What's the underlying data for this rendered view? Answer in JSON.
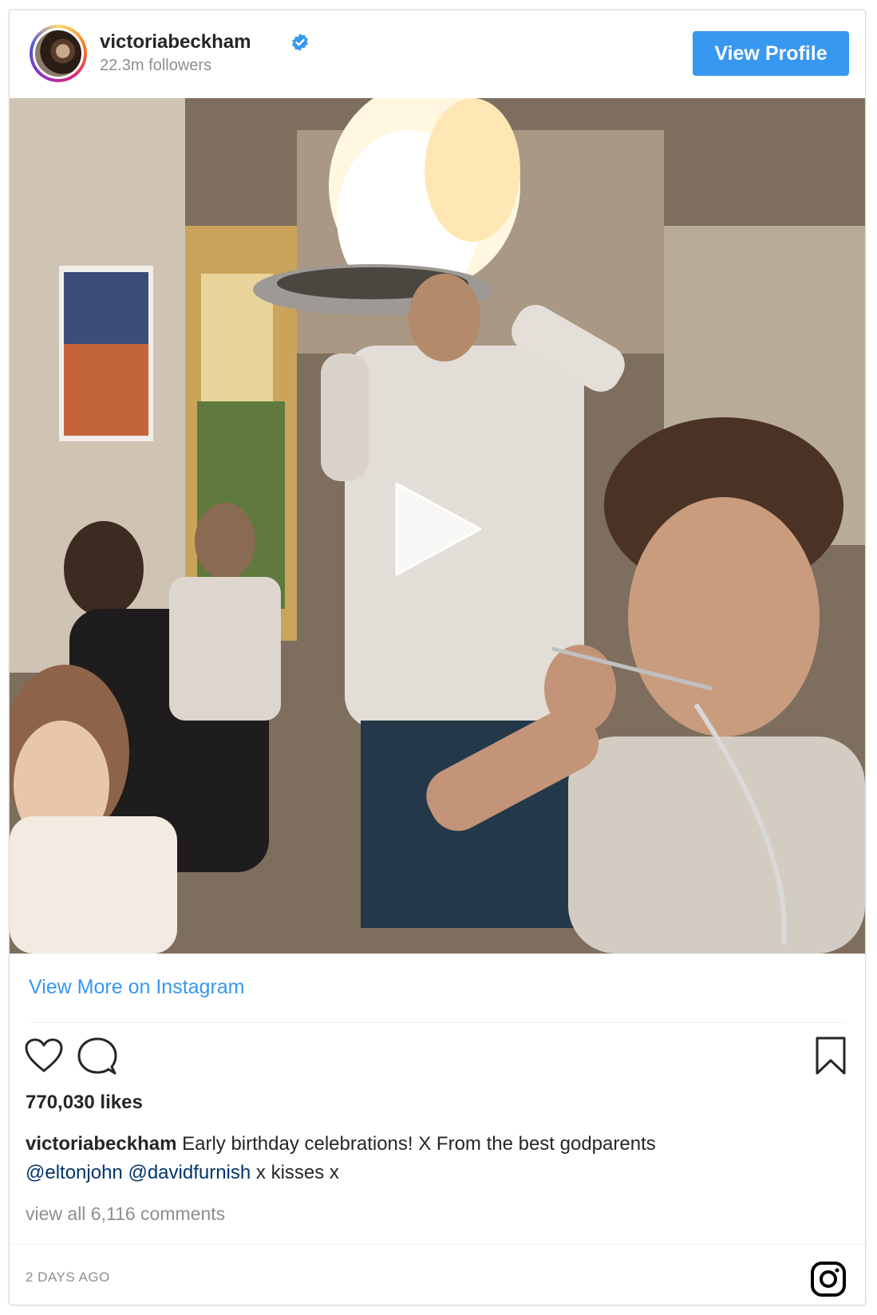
{
  "header": {
    "username": "victoriabeckham",
    "followers": "22.3m followers",
    "view_profile_label": "View Profile"
  },
  "media": {
    "type": "video",
    "play_icon": "play-icon"
  },
  "footer": {
    "view_more_label": "View More on Instagram",
    "icons": [
      "heart-icon",
      "comment-icon",
      "bookmark-icon",
      "instagram-logo-icon"
    ],
    "likes": "770,030 likes",
    "caption_user": "victoriabeckham",
    "caption_text": "Early birthday celebrations! X From the best godparents",
    "mention_1": "@eltonjohn",
    "mention_2": "@davidfurnish",
    "caption_tail": "x kisses x",
    "comments_label": "view all 6,116 comments",
    "timestamp": "2 DAYS AGO"
  },
  "colors": {
    "accent": "#3897f0",
    "mention": "#003569",
    "muted": "#8e8e8e",
    "text": "#262626"
  }
}
